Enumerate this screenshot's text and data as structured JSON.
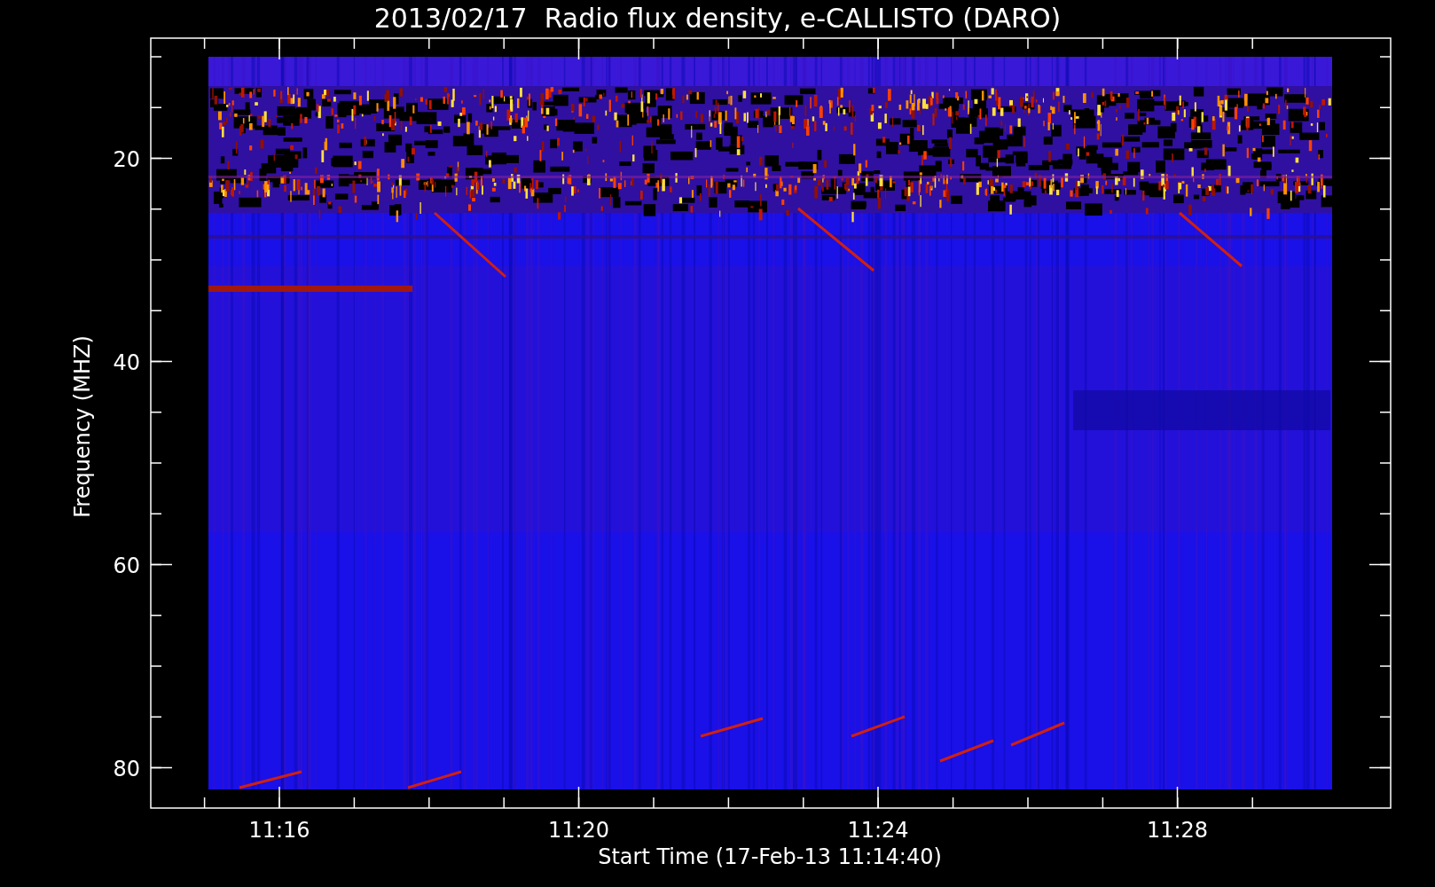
{
  "chart": {
    "title": "2013/02/17  Radio flux density, e-CALLISTO (DARO)",
    "ylabel": "Frequency (MHZ)",
    "xlabel": "Start Time (17-Feb-13 11:14:40)",
    "yticks": [
      "20",
      "40",
      "60",
      "80"
    ],
    "xticks": [
      "11:16",
      "11:20",
      "11:24",
      "11:28"
    ]
  }
}
